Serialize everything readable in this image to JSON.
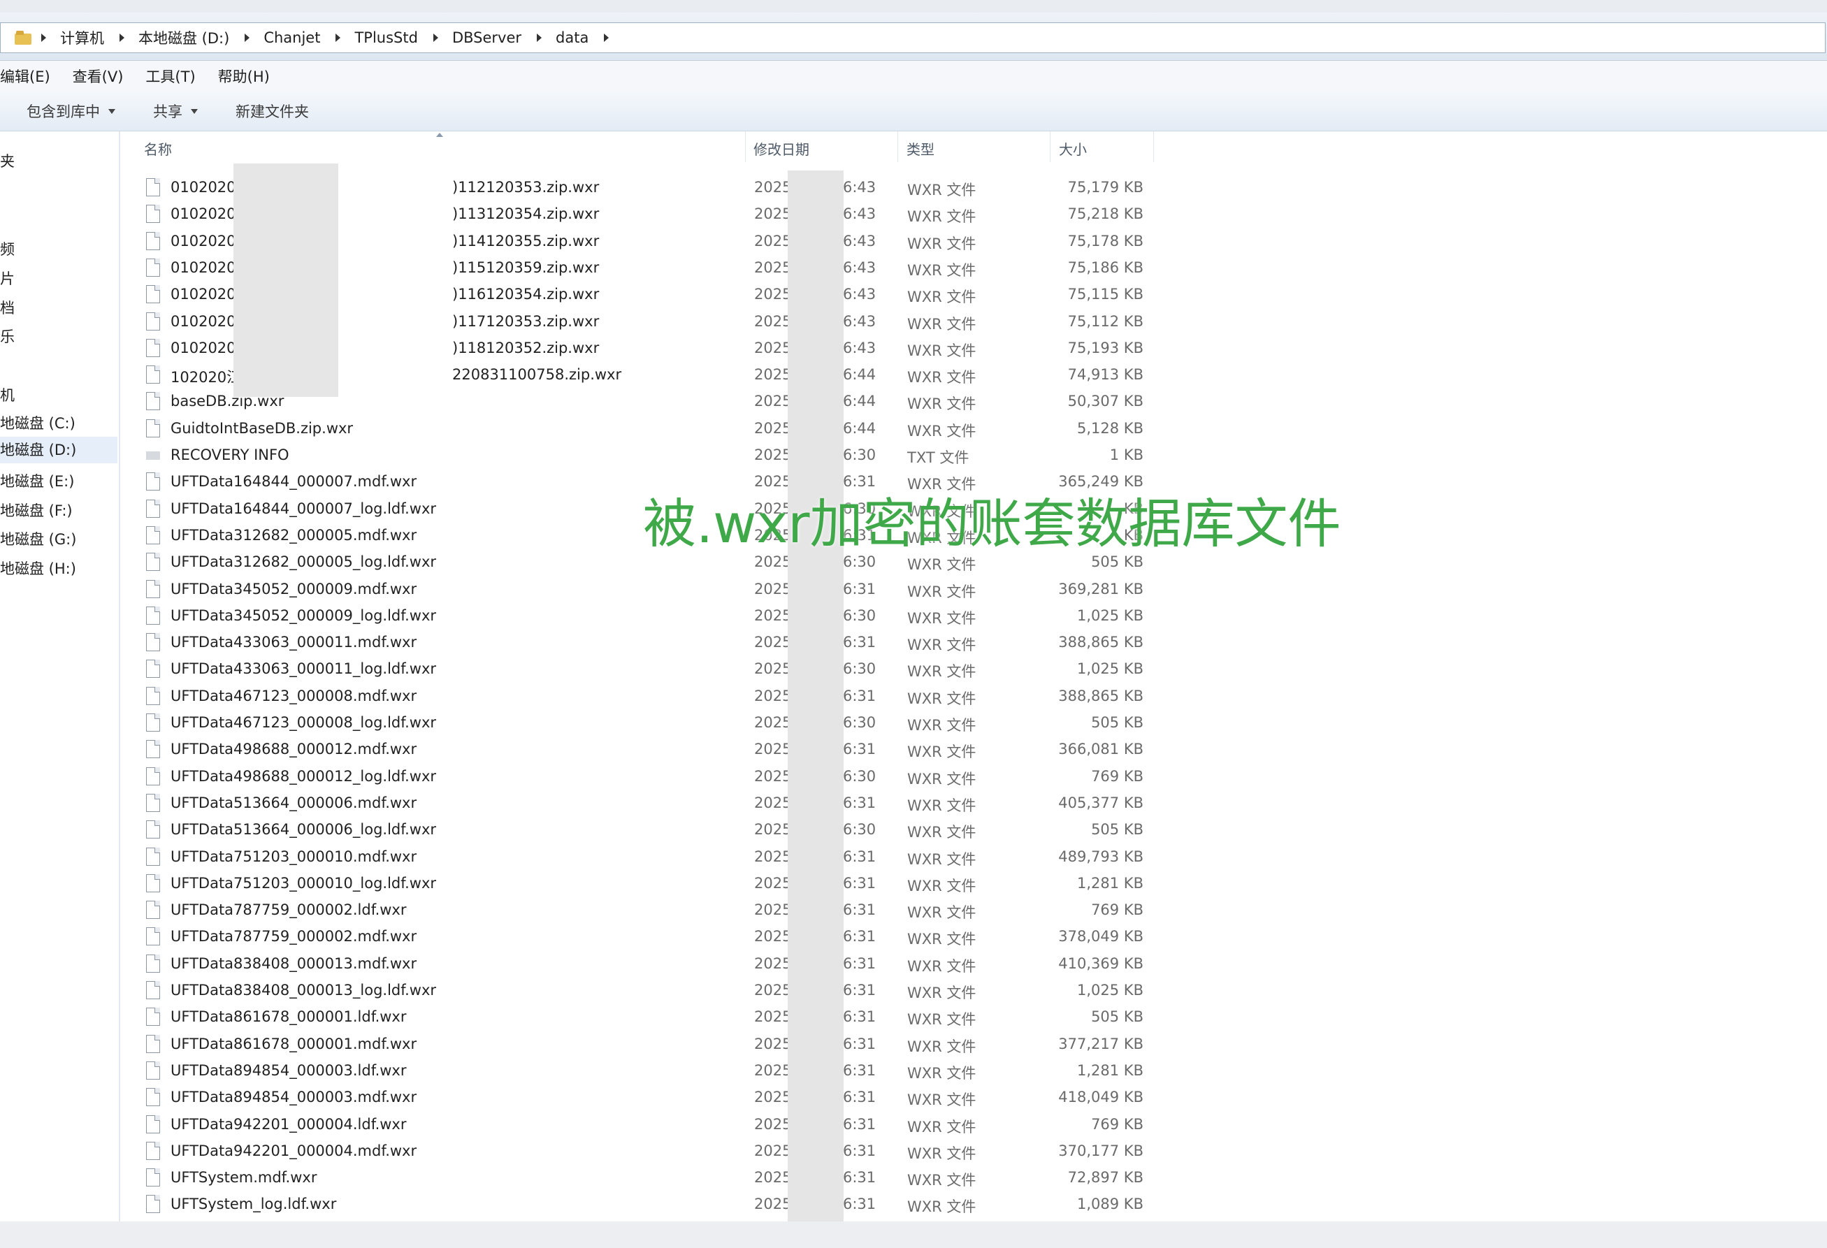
{
  "address": {
    "crumbs": [
      "计算机",
      "本地磁盘 (D:)",
      "Chanjet",
      "TPlusStd",
      "DBServer",
      "data"
    ]
  },
  "menu": [
    "编辑(E)",
    "查看(V)",
    "工具(T)",
    "帮助(H)"
  ],
  "toolbar": [
    "包含到库中",
    "共享",
    "新建文件夹"
  ],
  "nav": [
    "夹",
    "频",
    "片",
    "档",
    "乐",
    "机",
    "地磁盘 (C:)",
    "地磁盘 (D:)",
    "地磁盘 (E:)",
    "地磁盘 (F:)",
    "地磁盘 (G:)",
    "地磁盘 (H:)"
  ],
  "columns": {
    "name": "名称",
    "date": "修改日期",
    "type": "类型",
    "size": "大小"
  },
  "files": [
    {
      "name": "0102020",
      "name_tail": ")112120353.zip.wxr",
      "date": "2025",
      "time": "6:43",
      "type": "WXR 文件",
      "size": "75,179 KB"
    },
    {
      "name": "0102020",
      "name_tail": ")113120354.zip.wxr",
      "date": "2025",
      "time": "6:43",
      "type": "WXR 文件",
      "size": "75,218 KB"
    },
    {
      "name": "0102020",
      "name_tail": ")114120355.zip.wxr",
      "date": "2025",
      "time": "6:43",
      "type": "WXR 文件",
      "size": "75,178 KB"
    },
    {
      "name": "0102020",
      "name_tail": ")115120359.zip.wxr",
      "date": "2025",
      "time": "6:43",
      "type": "WXR 文件",
      "size": "75,186 KB"
    },
    {
      "name": "0102020",
      "name_tail": ")116120354.zip.wxr",
      "date": "2025",
      "time": "6:43",
      "type": "WXR 文件",
      "size": "75,115 KB"
    },
    {
      "name": "0102020",
      "name_tail": ")117120353.zip.wxr",
      "date": "2025",
      "time": "6:43",
      "type": "WXR 文件",
      "size": "75,112 KB"
    },
    {
      "name": "0102020",
      "name_tail": ")118120352.zip.wxr",
      "date": "2025",
      "time": "6:43",
      "type": "WXR 文件",
      "size": "75,193 KB"
    },
    {
      "name": "102020江",
      "name_tail": "220831100758.zip.wxr",
      "date": "2025",
      "time": "6:44",
      "type": "WXR 文件",
      "size": "74,913 KB"
    },
    {
      "name": "baseDB.zip.wxr",
      "name_tail": "",
      "date": "2025",
      "time": "6:44",
      "type": "WXR 文件",
      "size": "50,307 KB"
    },
    {
      "name": "GuidtoIntBaseDB.zip.wxr",
      "name_tail": "",
      "date": "2025",
      "time": "6:44",
      "type": "WXR 文件",
      "size": "5,128 KB"
    },
    {
      "name": "RECOVERY INFO",
      "name_tail": "",
      "date": "2025",
      "time": "6:30",
      "type": "TXT 文件",
      "size": "1 KB",
      "txt": true
    },
    {
      "name": "UFTData164844_000007.mdf.wxr",
      "name_tail": "",
      "date": "2025",
      "time": "6:31",
      "type": "WXR 文件",
      "size": "365,249 KB"
    },
    {
      "name": "UFTData164844_000007_log.ldf.wxr",
      "name_tail": "",
      "date": "2025",
      "time": "6:30",
      "type": "WXR 文件",
      "size": "KB"
    },
    {
      "name": "UFTData312682_000005.mdf.wxr",
      "name_tail": "",
      "date": "2025",
      "time": "6:31",
      "type": "WXR 文件",
      "size": "KB"
    },
    {
      "name": "UFTData312682_000005_log.ldf.wxr",
      "name_tail": "",
      "date": "2025",
      "time": "6:30",
      "type": "WXR 文件",
      "size": "505 KB"
    },
    {
      "name": "UFTData345052_000009.mdf.wxr",
      "name_tail": "",
      "date": "2025",
      "time": "6:31",
      "type": "WXR 文件",
      "size": "369,281 KB"
    },
    {
      "name": "UFTData345052_000009_log.ldf.wxr",
      "name_tail": "",
      "date": "2025",
      "time": "6:30",
      "type": "WXR 文件",
      "size": "1,025 KB"
    },
    {
      "name": "UFTData433063_000011.mdf.wxr",
      "name_tail": "",
      "date": "2025",
      "time": "6:31",
      "type": "WXR 文件",
      "size": "388,865 KB"
    },
    {
      "name": "UFTData433063_000011_log.ldf.wxr",
      "name_tail": "",
      "date": "2025",
      "time": "6:30",
      "type": "WXR 文件",
      "size": "1,025 KB"
    },
    {
      "name": "UFTData467123_000008.mdf.wxr",
      "name_tail": "",
      "date": "2025",
      "time": "6:31",
      "type": "WXR 文件",
      "size": "388,865 KB"
    },
    {
      "name": "UFTData467123_000008_log.ldf.wxr",
      "name_tail": "",
      "date": "2025",
      "time": "6:30",
      "type": "WXR 文件",
      "size": "505 KB"
    },
    {
      "name": "UFTData498688_000012.mdf.wxr",
      "name_tail": "",
      "date": "2025",
      "time": "6:31",
      "type": "WXR 文件",
      "size": "366,081 KB"
    },
    {
      "name": "UFTData498688_000012_log.ldf.wxr",
      "name_tail": "",
      "date": "2025",
      "time": "6:30",
      "type": "WXR 文件",
      "size": "769 KB"
    },
    {
      "name": "UFTData513664_000006.mdf.wxr",
      "name_tail": "",
      "date": "2025",
      "time": "6:31",
      "type": "WXR 文件",
      "size": "405,377 KB"
    },
    {
      "name": "UFTData513664_000006_log.ldf.wxr",
      "name_tail": "",
      "date": "2025",
      "time": "6:30",
      "type": "WXR 文件",
      "size": "505 KB"
    },
    {
      "name": "UFTData751203_000010.mdf.wxr",
      "name_tail": "",
      "date": "2025",
      "time": "6:31",
      "type": "WXR 文件",
      "size": "489,793 KB"
    },
    {
      "name": "UFTData751203_000010_log.ldf.wxr",
      "name_tail": "",
      "date": "2025",
      "time": "6:31",
      "type": "WXR 文件",
      "size": "1,281 KB"
    },
    {
      "name": "UFTData787759_000002.ldf.wxr",
      "name_tail": "",
      "date": "2025",
      "time": "6:31",
      "type": "WXR 文件",
      "size": "769 KB"
    },
    {
      "name": "UFTData787759_000002.mdf.wxr",
      "name_tail": "",
      "date": "2025",
      "time": "6:31",
      "type": "WXR 文件",
      "size": "378,049 KB"
    },
    {
      "name": "UFTData838408_000013.mdf.wxr",
      "name_tail": "",
      "date": "2025",
      "time": "6:31",
      "type": "WXR 文件",
      "size": "410,369 KB"
    },
    {
      "name": "UFTData838408_000013_log.ldf.wxr",
      "name_tail": "",
      "date": "2025",
      "time": "6:31",
      "type": "WXR 文件",
      "size": "1,025 KB"
    },
    {
      "name": "UFTData861678_000001.ldf.wxr",
      "name_tail": "",
      "date": "2025",
      "time": "6:31",
      "type": "WXR 文件",
      "size": "505 KB"
    },
    {
      "name": "UFTData861678_000001.mdf.wxr",
      "name_tail": "",
      "date": "2025",
      "time": "6:31",
      "type": "WXR 文件",
      "size": "377,217 KB"
    },
    {
      "name": "UFTData894854_000003.ldf.wxr",
      "name_tail": "",
      "date": "2025",
      "time": "6:31",
      "type": "WXR 文件",
      "size": "1,281 KB"
    },
    {
      "name": "UFTData894854_000003.mdf.wxr",
      "name_tail": "",
      "date": "2025",
      "time": "6:31",
      "type": "WXR 文件",
      "size": "418,049 KB"
    },
    {
      "name": "UFTData942201_000004.ldf.wxr",
      "name_tail": "",
      "date": "2025",
      "time": "6:31",
      "type": "WXR 文件",
      "size": "769 KB"
    },
    {
      "name": "UFTData942201_000004.mdf.wxr",
      "name_tail": "",
      "date": "2025",
      "time": "6:31",
      "type": "WXR 文件",
      "size": "370,177 KB"
    },
    {
      "name": "UFTSystem.mdf.wxr",
      "name_tail": "",
      "date": "2025",
      "time": "6:31",
      "type": "WXR 文件",
      "size": "72,897 KB"
    },
    {
      "name": "UFTSystem_log.ldf.wxr",
      "name_tail": "",
      "date": "2025",
      "time": "6:31",
      "type": "WXR 文件",
      "size": "1,089 KB"
    }
  ],
  "overlay_caption": "被.wxr加密的账套数据库文件",
  "colors": {
    "caption": "#3fa848",
    "selection": "#e5eef9",
    "folder": "#e8c154"
  }
}
